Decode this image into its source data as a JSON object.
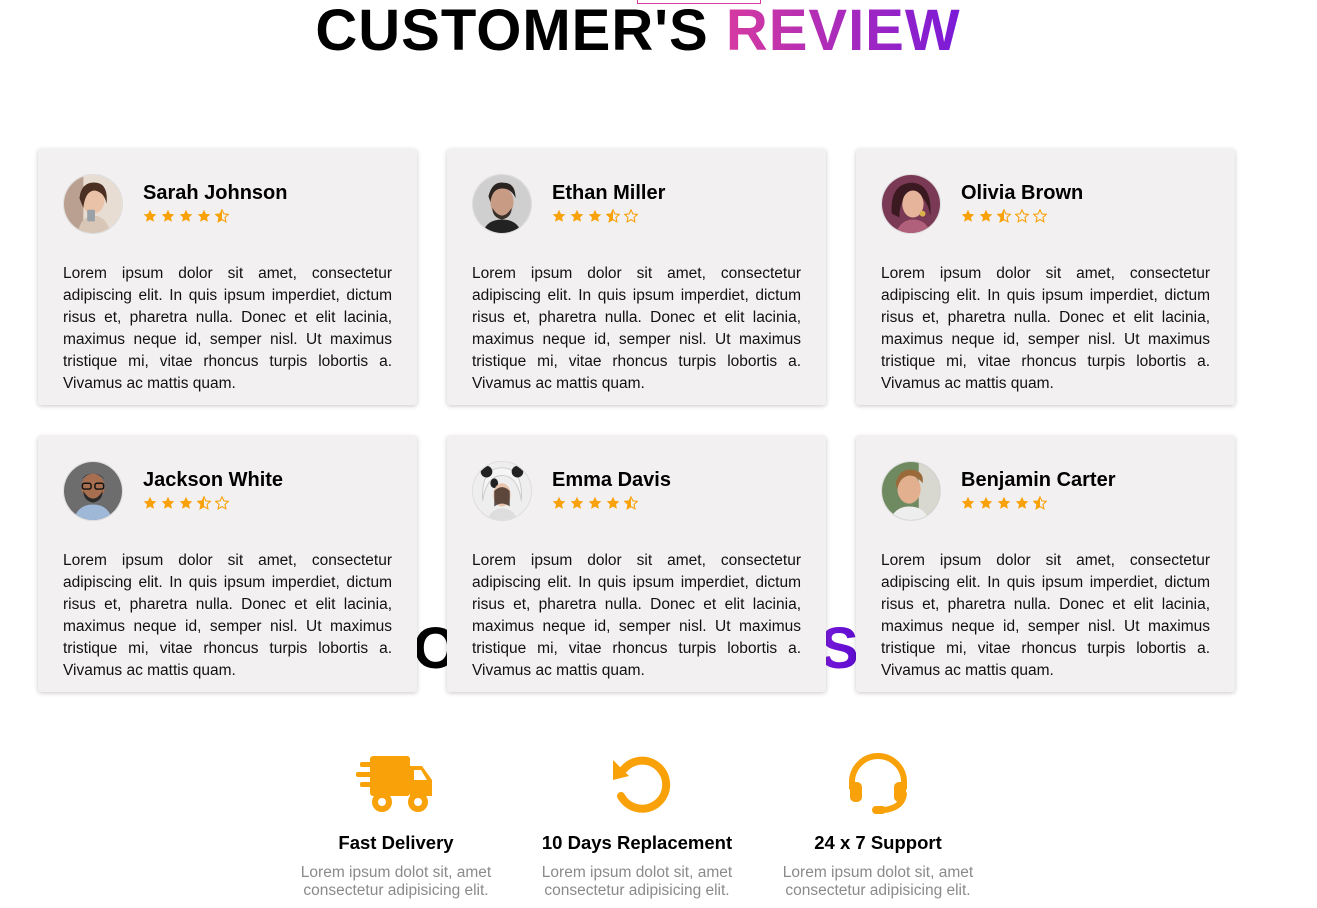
{
  "heading": {
    "part1": "CUSTOMER'S ",
    "part2": "REVIEW"
  },
  "services_heading": {
    "left_fragment": "O",
    "right_fragment": "S"
  },
  "colors": {
    "star": "#f9a109",
    "accent_start": "#d63aa0",
    "accent_end": "#7a1ad8",
    "feature_icon": "#f9a109",
    "card_bg": "#f2f0f1"
  },
  "reviews": [
    {
      "name": "Sarah Johnson",
      "rating": 4.5,
      "text": "Lorem ipsum dolor sit amet, consectetur adipiscing elit. In quis ipsum imperdiet, dictum risus et, pharetra nulla. Donec et elit lacinia, maximus neque id, semper nisl. Ut maximus tristique mi, vitae rhoncus turpis lobortis a. Vivamus ac mattis quam.",
      "avatar": "woman-selfie-photo"
    },
    {
      "name": "Ethan Miller",
      "rating": 3.5,
      "text": "Lorem ipsum dolor sit amet, consectetur adipiscing elit. In quis ipsum imperdiet, dictum risus et, pharetra nulla. Donec et elit lacinia, maximus neque id, semper nisl. Ut maximus tristique mi, vitae rhoncus turpis lobortis a. Vivamus ac mattis quam.",
      "avatar": "bearded-man-photo"
    },
    {
      "name": "Olivia Brown",
      "rating": 2.5,
      "text": "Lorem ipsum dolor sit amet, consectetur adipiscing elit. In quis ipsum imperdiet, dictum risus et, pharetra nulla. Donec et elit lacinia, maximus neque id, semper nisl. Ut maximus tristique mi, vitae rhoncus turpis lobortis a. Vivamus ac mattis quam.",
      "avatar": "woman-portrait-photo"
    },
    {
      "name": "Jackson White",
      "rating": 3.5,
      "text": "Lorem ipsum dolor sit amet, consectetur adipiscing elit. In quis ipsum imperdiet, dictum risus et, pharetra nulla. Donec et elit lacinia, maximus neque id, semper nisl. Ut maximus tristique mi, vitae rhoncus turpis lobortis a. Vivamus ac mattis quam.",
      "avatar": "smiling-man-glasses-photo"
    },
    {
      "name": "Emma Davis",
      "rating": 4.5,
      "text": "Lorem ipsum dolor sit amet, consectetur adipiscing elit. In quis ipsum imperdiet, dictum risus et, pharetra nulla. Donec et elit lacinia, maximus neque id, semper nisl. Ut maximus tristique mi, vitae rhoncus turpis lobortis a. Vivamus ac mattis quam.",
      "avatar": "woman-panda-hat-photo"
    },
    {
      "name": "Benjamin Carter",
      "rating": 4.5,
      "text": "Lorem ipsum dolor sit amet, consectetur adipiscing elit. In quis ipsum imperdiet, dictum risus et, pharetra nulla. Donec et elit lacinia, maximus neque id, semper nisl. Ut maximus tristique mi, vitae rhoncus turpis lobortis a. Vivamus ac mattis quam.",
      "avatar": "young-man-photo"
    }
  ],
  "features": [
    {
      "title": "Fast Delivery",
      "text": "Lorem ipsum dolot sit, amet consectetur adipisicing elit.",
      "icon": "truck-fast-icon"
    },
    {
      "title": "10 Days Replacement",
      "text": "Lorem ipsum dolot sit, amet consectetur adipisicing elit.",
      "icon": "rotate-left-icon"
    },
    {
      "title": "24 x 7 Support",
      "text": "Lorem ipsum dolot sit, amet consectetur adipisicing elit.",
      "icon": "headset-icon"
    }
  ]
}
